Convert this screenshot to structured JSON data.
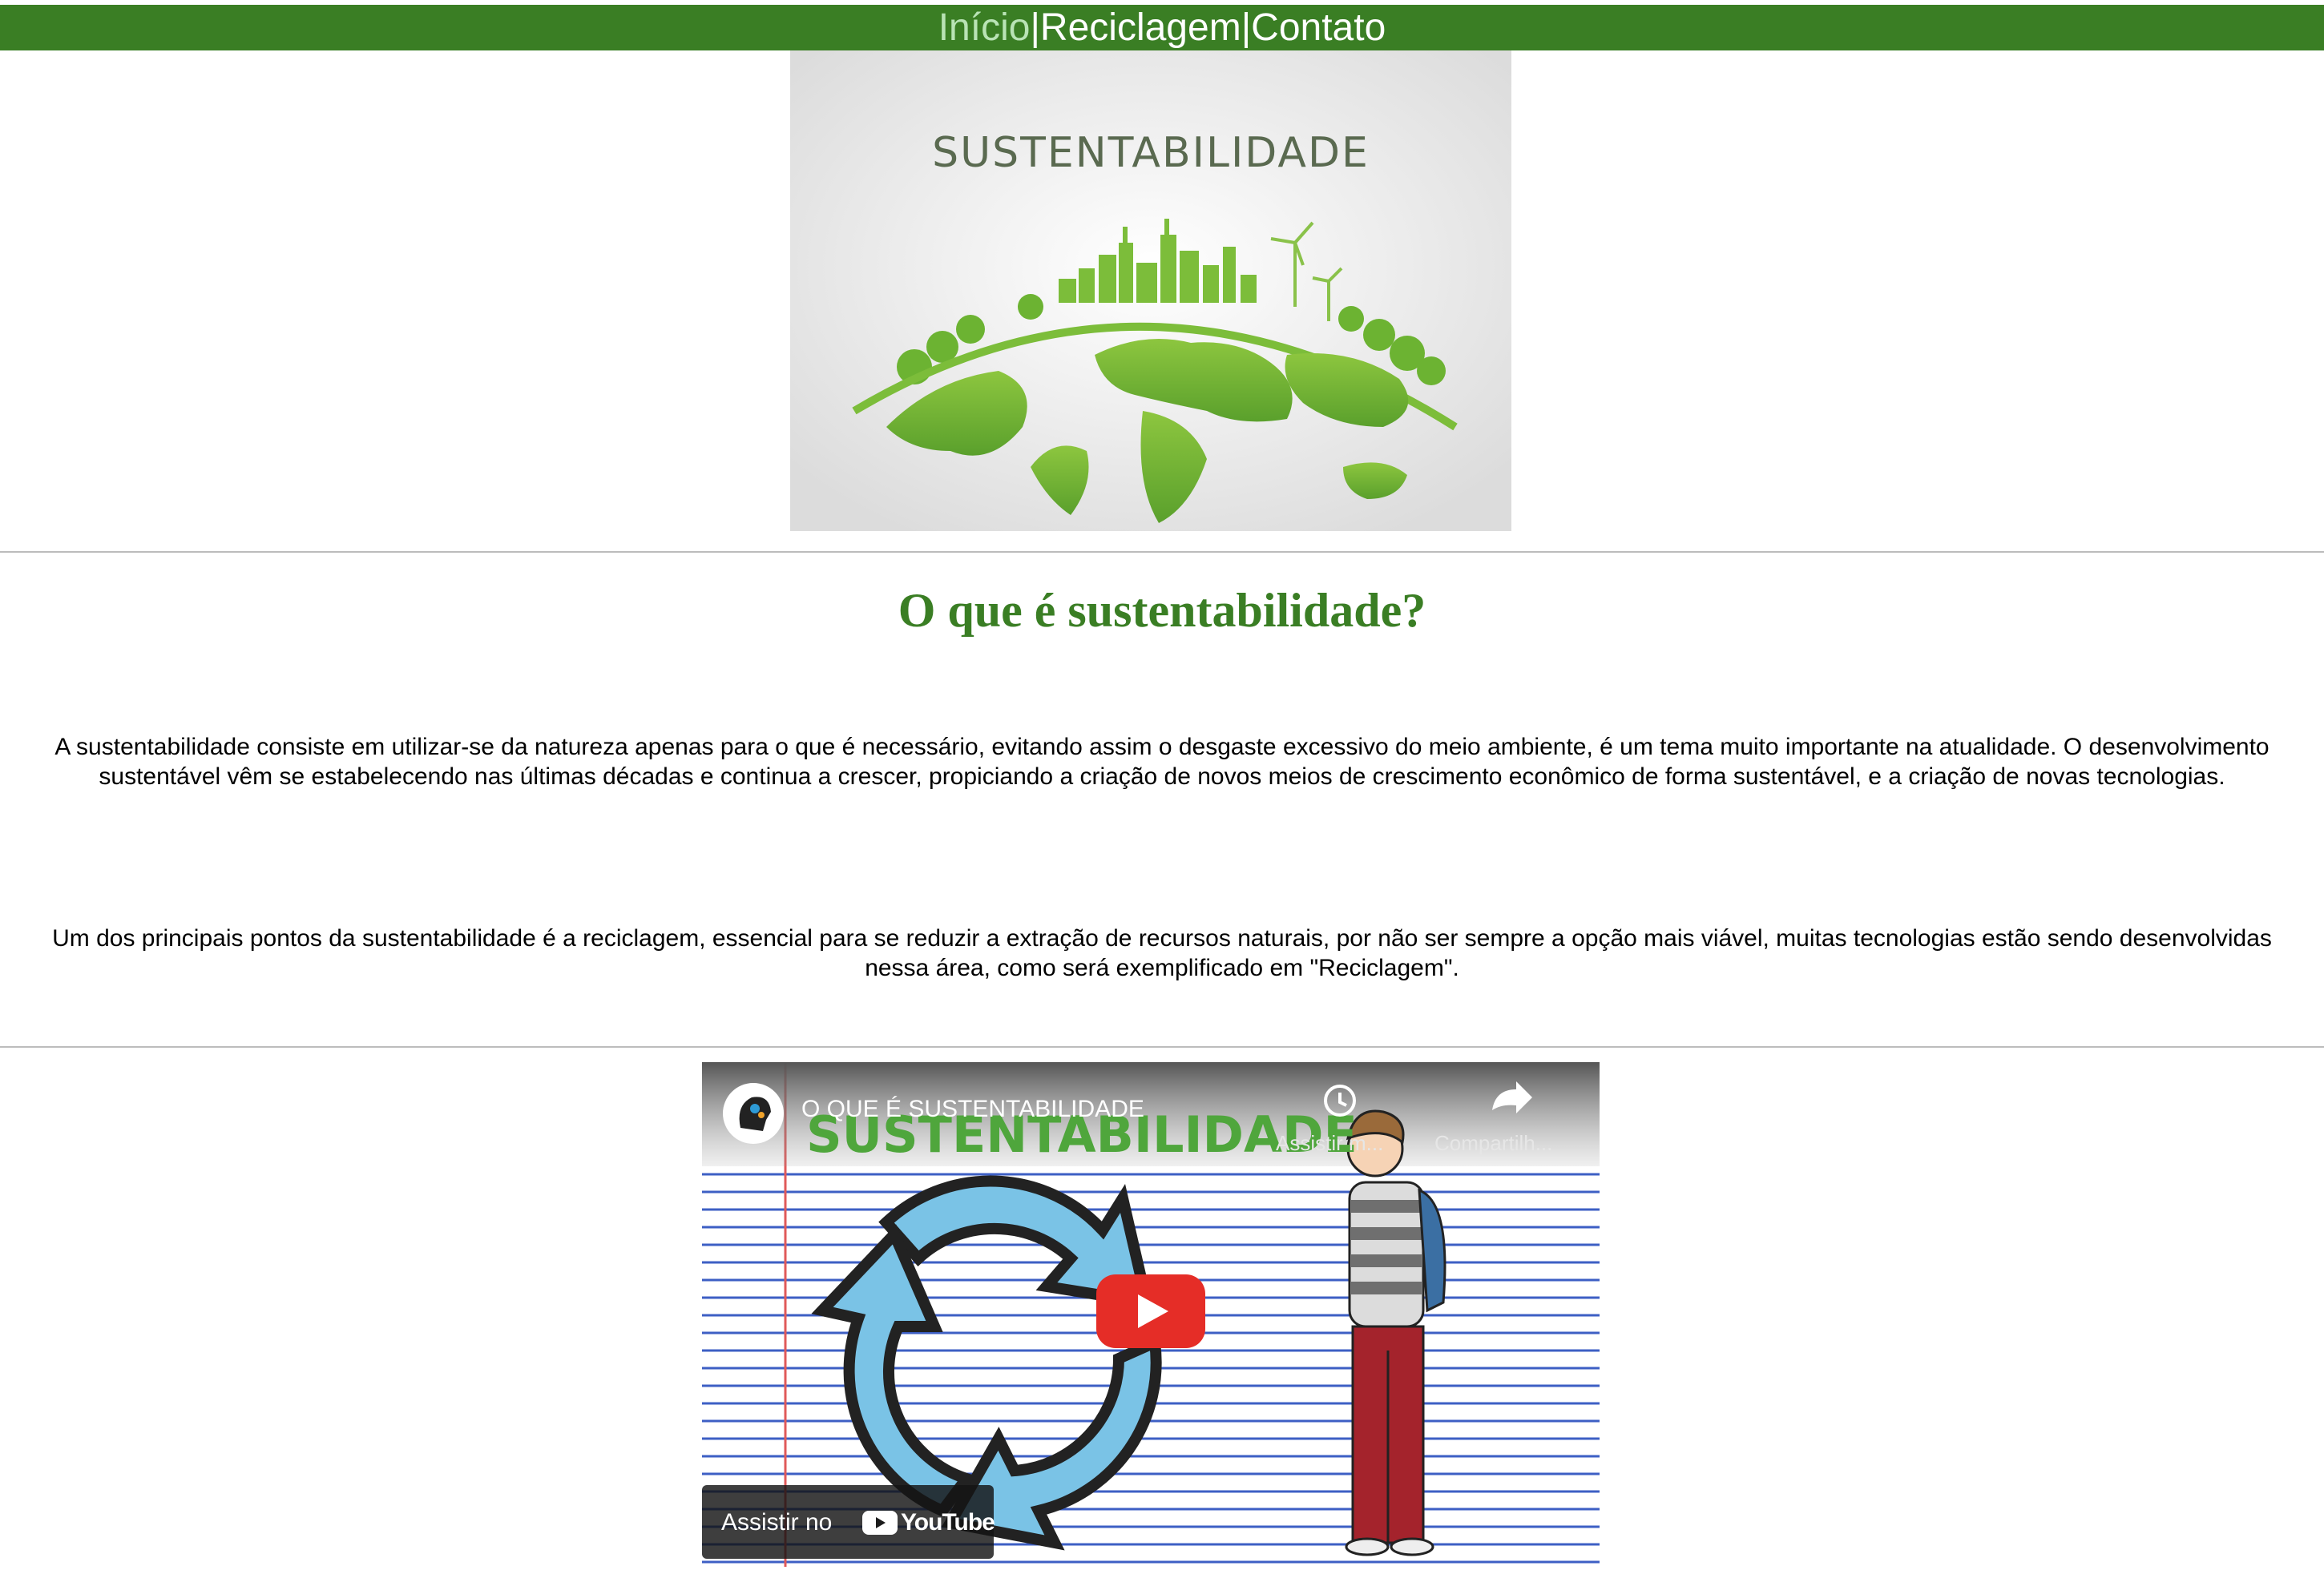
{
  "nav": {
    "items": [
      {
        "label": "Início",
        "active": true
      },
      {
        "label": "Reciclagem",
        "active": false
      },
      {
        "label": "Contato",
        "active": false
      }
    ],
    "separator": "|",
    "background_color": "#3a7e24",
    "active_color": "#b9e3b5"
  },
  "hero": {
    "headline": "SUSTENTABILIDADE"
  },
  "main": {
    "heading": "O que é sustentabilidade?",
    "paragraphs": [
      "A sustentabilidade consiste em utilizar-se da natureza apenas para o que é necessário, evitando assim o desgaste excessivo do meio ambiente, é um tema muito importante na atualidade. O desenvolvimento sustentável vêm se estabelecendo nas últimas décadas e continua a crescer, propiciando a criação de novos meios de crescimento econômico de forma sustentável, e a criação de novas tecnologias.",
      "Um dos principais pontos da sustentabilidade é a reciclagem, essencial para se reduzir a extração de recursos naturais, por não ser sempre a opção mais viável, muitas tecnologias estão sendo desenvolvidas nessa área, como será exemplificado em \"Reciclagem\"."
    ],
    "heading_color": "#3a7e24"
  },
  "video": {
    "title": "O QUE É SUSTENTABILIDADE",
    "thumbnail_headline": "SUSTENTABILIDADE",
    "watch_later_label": "Assistir m...",
    "share_label": "Compartilh...",
    "watch_on_label": "Assistir no",
    "platform": "YouTube",
    "play_button_color": "#e52d27"
  }
}
